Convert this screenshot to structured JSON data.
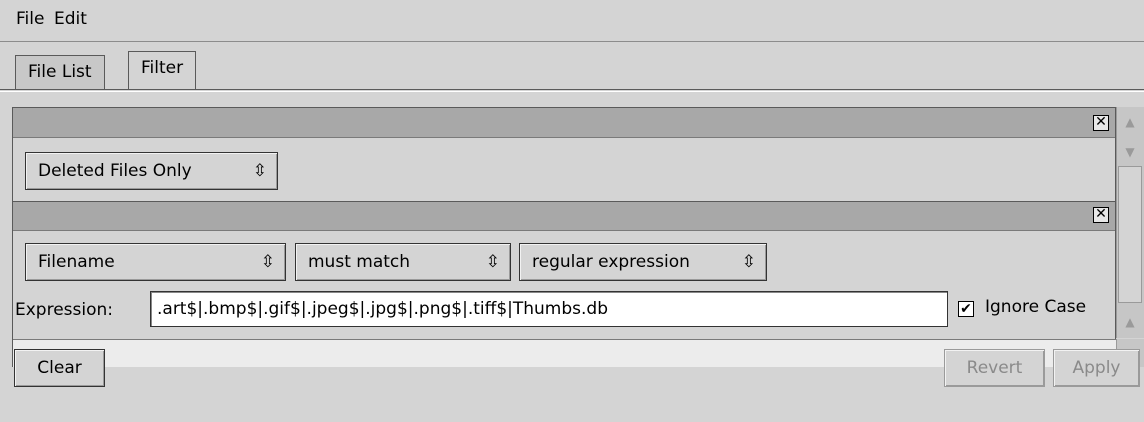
{
  "menu": {
    "items": [
      "File",
      "Edit"
    ]
  },
  "tabs": [
    {
      "label": "File List",
      "active": false
    },
    {
      "label": "Filter",
      "active": true
    }
  ],
  "filters": [
    {
      "kind": "Deleted Files Only"
    },
    {
      "field": "Filename",
      "condition": "must match",
      "mode": "regular expression",
      "expression_label": "Expression:",
      "expression_value": ".art$|.bmp$|.gif$|.jpeg$|.jpg$|.png$|.tiff$|Thumbs.db",
      "ignore_case_label": "Ignore Case",
      "ignore_case_checked": true
    }
  ],
  "close_glyph": "✕",
  "buttons": {
    "clear": "Clear",
    "revert": "Revert",
    "apply": "Apply"
  },
  "icons": {
    "combo_arrow": "updown-arrows-icon",
    "close": "close-icon",
    "checkmark": "check-icon"
  },
  "colors": {
    "background": "#d4d4d4",
    "strip": "#a8a8a8",
    "disabled_text": "#8a8a8a"
  }
}
